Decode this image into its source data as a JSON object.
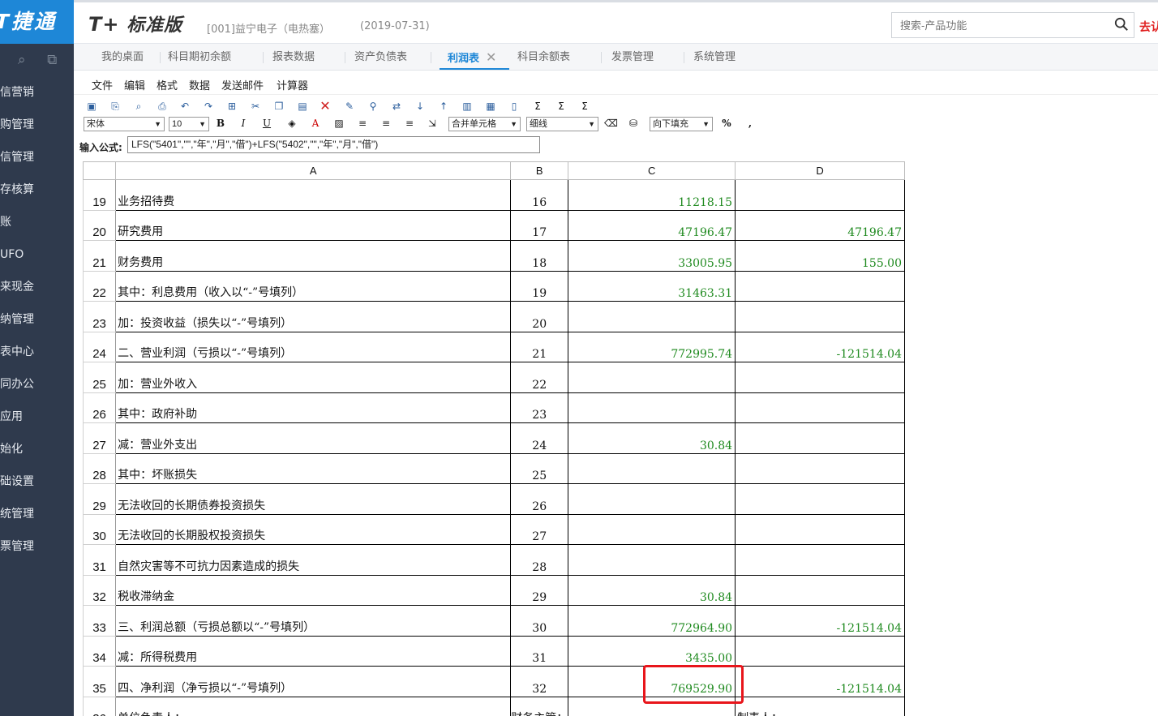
{
  "sidebar": {
    "brand": "T捷通",
    "items": [
      "信营销",
      "购管理",
      "信管理",
      "存核算",
      "账",
      "UFO",
      "来现金",
      "纳管理",
      "表中心",
      "同办公",
      "应用",
      "始化",
      "础设置",
      "统管理",
      "票管理"
    ]
  },
  "header": {
    "logo_prefix": "T+",
    "logo_text": "标准版",
    "company": "[001]益宁电子（电热塞）",
    "date": "(2019-07-31)",
    "search_placeholder": "搜索-产品功能",
    "right_link": "去认"
  },
  "tabs": [
    {
      "label": "我的桌面"
    },
    {
      "label": "科目期初余额"
    },
    {
      "label": "报表数据"
    },
    {
      "label": "资产负债表"
    },
    {
      "label": "利润表"
    },
    {
      "label": "科目余额表"
    },
    {
      "label": "发票管理"
    },
    {
      "label": "系统管理"
    }
  ],
  "menu": [
    "文件",
    "编辑",
    "格式",
    "数据",
    "发送邮件",
    "计算器"
  ],
  "toolbar": {
    "font": "宋体",
    "size": "10",
    "merge": "合并单元格",
    "line": "细线",
    "fill": "向下填充",
    "percent": "%",
    "comma": ","
  },
  "formula": {
    "label": "输入公式:",
    "value": "LFS(\"5401\",\"\",\"年\",\"月\",\"借\")+LFS(\"5402\",\"\",\"年\",\"月\",\"借\")"
  },
  "columns": [
    "A",
    "B",
    "C",
    "D"
  ],
  "rows": [
    {
      "n": "19",
      "a": "业务招待费",
      "ind": 3,
      "b": "16",
      "c": "11218.15",
      "d": ""
    },
    {
      "n": "20",
      "a": "研究费用",
      "ind": 3,
      "b": "17",
      "c": "47196.47",
      "d": "47196.47"
    },
    {
      "n": "21",
      "a": "财务费用",
      "ind": 0,
      "b": "18",
      "c": "33005.95",
      "d": "155.00"
    },
    {
      "n": "22",
      "a": "其中：利息费用（收入以“-”号填列）",
      "ind": 1,
      "b": "19",
      "c": "31463.31",
      "d": ""
    },
    {
      "n": "23",
      "a": "加：投资收益（损失以“-”号填列）",
      "ind": 0,
      "b": "20",
      "c": "",
      "d": ""
    },
    {
      "n": "24",
      "a": "二、营业利润（亏损以“-”号填列）",
      "ind": 0,
      "b": "21",
      "c": "772995.74",
      "d": "-121514.04"
    },
    {
      "n": "25",
      "a": "加：营业外收入",
      "ind": 0,
      "b": "22",
      "c": "",
      "d": ""
    },
    {
      "n": "26",
      "a": "其中：政府补助",
      "ind": 1,
      "b": "23",
      "c": "",
      "d": ""
    },
    {
      "n": "27",
      "a": "减：营业外支出",
      "ind": 0,
      "b": "24",
      "c": "30.84",
      "d": ""
    },
    {
      "n": "28",
      "a": "其中：坏账损失",
      "ind": 0,
      "b": "25",
      "c": "",
      "d": ""
    },
    {
      "n": "29",
      "a": "无法收回的长期债券投资损失",
      "ind": 2,
      "b": "26",
      "c": "",
      "d": ""
    },
    {
      "n": "30",
      "a": "无法收回的长期股权投资损失",
      "ind": 2,
      "b": "27",
      "c": "",
      "d": ""
    },
    {
      "n": "31",
      "a": "自然灾害等不可抗力因素造成的损失",
      "ind": 2,
      "b": "28",
      "c": "",
      "d": ""
    },
    {
      "n": "32",
      "a": "税收滞纳金",
      "ind": 2,
      "b": "29",
      "c": "30.84",
      "d": ""
    },
    {
      "n": "33",
      "a": "三、利润总额（亏损总额以“-”号填列）",
      "ind": 0,
      "b": "30",
      "c": "772964.90",
      "d": "-121514.04"
    },
    {
      "n": "34",
      "a": "减：所得税费用",
      "ind": 0,
      "b": "31",
      "c": "3435.00",
      "d": ""
    },
    {
      "n": "35",
      "a": "四、净利润（净亏损以“-”号填列）",
      "ind": 0,
      "b": "32",
      "c": "769529.90",
      "d": "-121514.04"
    },
    {
      "n": "36",
      "a": "单位负责人：",
      "ind": 0,
      "b": "财务主管：",
      "c": "",
      "d": "制表人："
    }
  ],
  "colors": {
    "brand_blue": "#1e87d7",
    "sidebar": "#2f3a4d",
    "value_green": "#1f8a1f",
    "highlight_red": "#e8151b"
  }
}
